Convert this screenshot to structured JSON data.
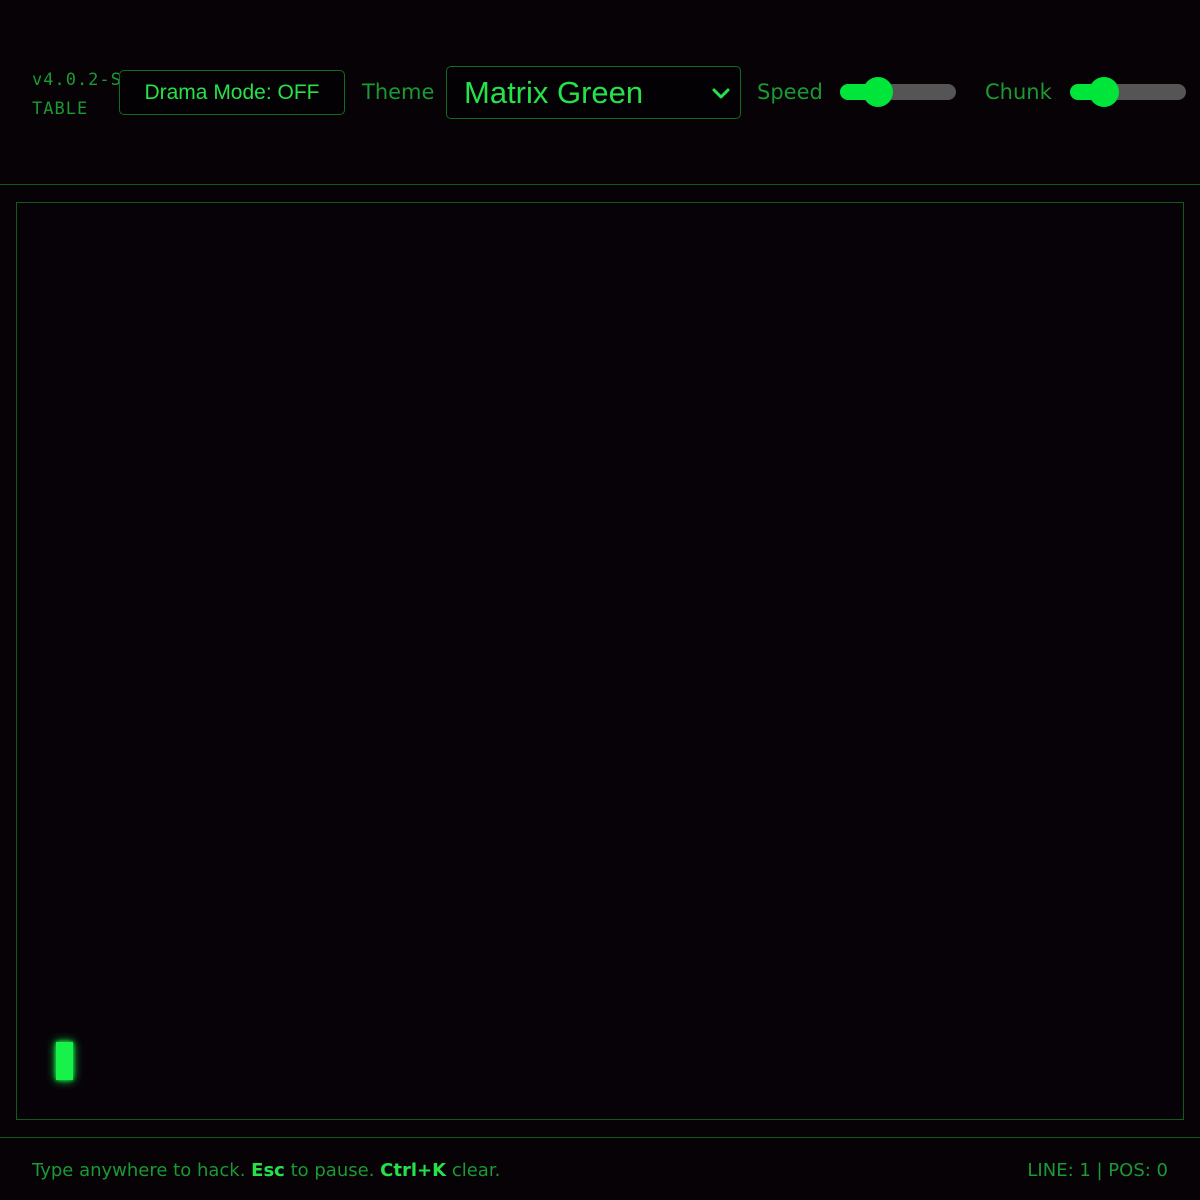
{
  "header": {
    "version": "v4.0.2-STABLE",
    "drama_button_label": "Drama Mode: OFF",
    "theme_label": "Theme",
    "theme_value": "Matrix Green",
    "speed_label": "Speed",
    "speed_level": 0.33,
    "chunk_label": "Chunk",
    "chunk_level": 0.29
  },
  "footer": {
    "hint_prefix": "Type anywhere to hack.",
    "hint_key1": "Esc",
    "hint_mid": "to pause.",
    "hint_key2": "Ctrl+K",
    "hint_suffix": "clear.",
    "status": "LINE: 1 | POS: 0"
  },
  "colors": {
    "accent": "#26e24a",
    "dim": "#1a9a32",
    "border": "#0f5a1c",
    "background": "#060206"
  }
}
